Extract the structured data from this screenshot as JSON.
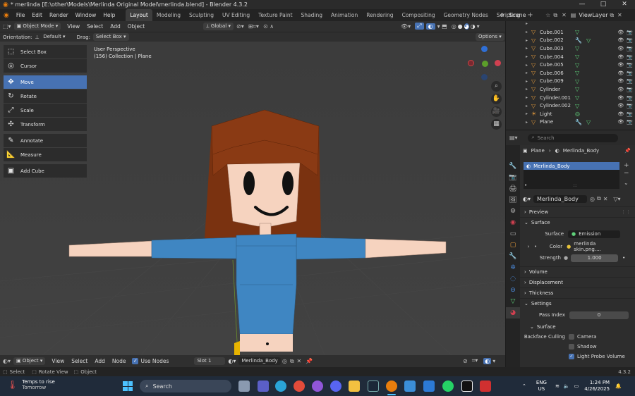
{
  "window": {
    "title": "* merlinda [E:\\other\\Models\\Merlinda Original Model\\merlinda.blend] - Blender 4.3.2"
  },
  "topbar": {
    "menus": [
      "File",
      "Edit",
      "Render",
      "Window",
      "Help"
    ],
    "workspaces": [
      "Layout",
      "Modeling",
      "Sculpting",
      "UV Editing",
      "Texture Paint",
      "Shading",
      "Animation",
      "Rendering",
      "Compositing",
      "Geometry Nodes",
      "Scripting"
    ],
    "active_workspace": "Layout",
    "scene": "Scene",
    "view_layer": "ViewLayer"
  },
  "viewport_header": {
    "mode": "Object Mode",
    "menus": [
      "View",
      "Select",
      "Add",
      "Object"
    ],
    "transform_orientation": "Global"
  },
  "tool_settings": {
    "orientation_label": "Orientation:",
    "orientation_value": "Default",
    "drag_label": "Drag:",
    "drag_value": "Select Box",
    "options": "Options"
  },
  "viewport": {
    "perspective": "User Perspective",
    "collection_info": "(156) Collection | Plane"
  },
  "tools": [
    {
      "label": "Select Box",
      "icon": "select-box-icon",
      "selected": false
    },
    {
      "label": "Cursor",
      "icon": "cursor-icon",
      "selected": false
    },
    {
      "label": "Move",
      "icon": "move-icon",
      "selected": true
    },
    {
      "label": "Rotate",
      "icon": "rotate-icon",
      "selected": false
    },
    {
      "label": "Scale",
      "icon": "scale-icon",
      "selected": false
    },
    {
      "label": "Transform",
      "icon": "transform-icon",
      "selected": false
    },
    {
      "label": "Annotate",
      "icon": "annotate-icon",
      "selected": false
    },
    {
      "label": "Measure",
      "icon": "measure-icon",
      "selected": false
    },
    {
      "label": "Add Cube",
      "icon": "add-cube-icon",
      "selected": false
    }
  ],
  "outliner": {
    "items": [
      "Cube.001",
      "Cube.002",
      "Cube.003",
      "Cube.004",
      "Cube.005",
      "Cube.006",
      "Cube.009",
      "Cylinder",
      "Cylinder.001",
      "Cylinder.002",
      "Light",
      "Plane"
    ]
  },
  "properties": {
    "search_placeholder": "Search",
    "breadcrumb_object": "Plane",
    "breadcrumb_material": "Merlinda_Body",
    "slot_material": "Merlinda_Body",
    "material_name": "Merlinda_Body",
    "preview": "Preview",
    "surface": "Surface",
    "surface_label": "Surface",
    "surface_value": "Emission",
    "color_label": "Color",
    "color_value": "merlinda skin.png....",
    "strength_label": "Strength",
    "strength_value": "1.000",
    "volume": "Volume",
    "displacement": "Displacement",
    "thickness": "Thickness",
    "settings": "Settings",
    "pass_index_label": "Pass Index",
    "pass_index_value": "0",
    "surface_sub": "Surface",
    "backface_culling": "Backface Culling",
    "camera": "Camera",
    "shadow": "Shadow",
    "light_probe_volume": "Light Probe Volume"
  },
  "shader_header": {
    "type": "Object",
    "menus": [
      "View",
      "Select",
      "Add",
      "Node"
    ],
    "use_nodes": "Use Nodes",
    "slot": "Slot 1",
    "material": "Merlinda_Body"
  },
  "statusbar": {
    "select": "Select",
    "rotate_view": "Rotate View",
    "object": "Object",
    "version": "4.3.2"
  },
  "taskbar": {
    "weather_title": "Temps to rise",
    "weather_sub": "Tomorrow",
    "search": "Search",
    "lang": "ENG",
    "region": "US",
    "time": "1:24 PM",
    "date": "4/26/2025"
  },
  "colors": {
    "accent_blue": "#4772b3",
    "hair": "#7a3210",
    "skin": "#f6d3bf",
    "shirt": "#3f86c2"
  }
}
